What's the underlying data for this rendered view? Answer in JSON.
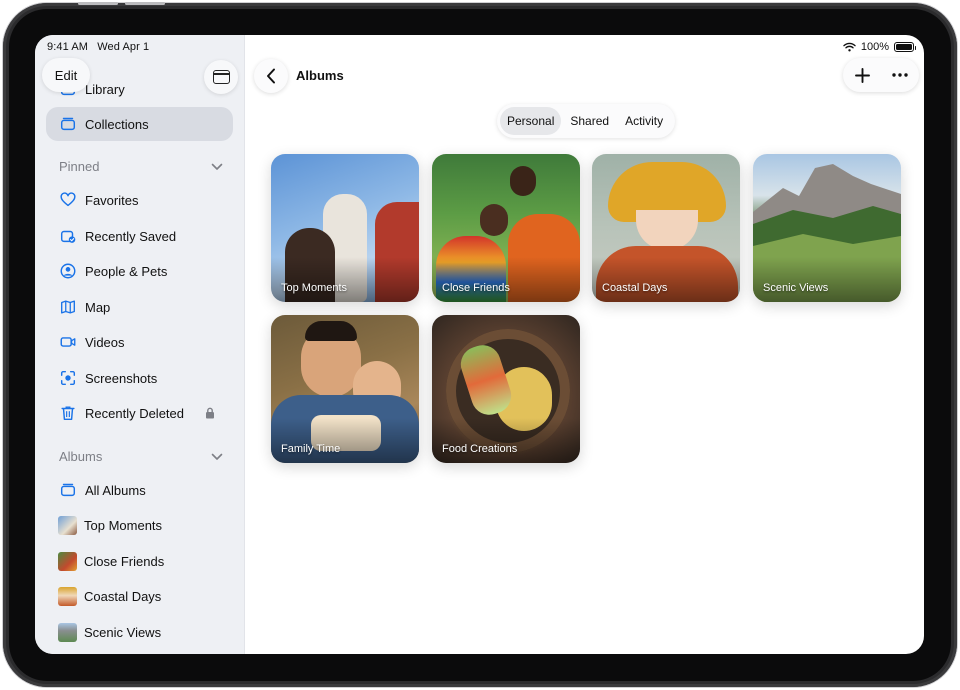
{
  "status": {
    "time": "9:41 AM",
    "date": "Wed Apr 1",
    "battery": "100%"
  },
  "sidebar": {
    "edit_label": "Edit",
    "items_top": [
      {
        "label": "Library",
        "icon": "library-icon"
      },
      {
        "label": "Collections",
        "icon": "collections-icon",
        "selected": true
      }
    ],
    "pinned_header": "Pinned",
    "pinned": [
      {
        "label": "Favorites",
        "icon": "heart-icon"
      },
      {
        "label": "Recently Saved",
        "icon": "recently-saved-icon"
      },
      {
        "label": "People & Pets",
        "icon": "person-circle-icon"
      },
      {
        "label": "Map",
        "icon": "map-icon"
      },
      {
        "label": "Videos",
        "icon": "video-icon"
      },
      {
        "label": "Screenshots",
        "icon": "screenshot-icon"
      },
      {
        "label": "Recently Deleted",
        "icon": "trash-icon",
        "locked": true
      }
    ],
    "albums_header": "Albums",
    "albums": [
      {
        "label": "All Albums",
        "icon": "albums-icon"
      },
      {
        "label": "Top Moments",
        "thumb": "#6f9fd6"
      },
      {
        "label": "Close Friends",
        "thumb": "#c24a2e"
      },
      {
        "label": "Coastal Days",
        "thumb": "#c35a2a"
      },
      {
        "label": "Scenic Views",
        "thumb": "#5d8a52"
      }
    ]
  },
  "main": {
    "title": "Albums",
    "segments": [
      {
        "label": "Personal",
        "active": true
      },
      {
        "label": "Shared",
        "active": false
      },
      {
        "label": "Activity",
        "active": false
      }
    ],
    "albums": [
      {
        "title": "Top Moments",
        "art": "art-top"
      },
      {
        "title": "Close Friends",
        "art": "art-friends"
      },
      {
        "title": "Coastal Days",
        "art": "art-coastal"
      },
      {
        "title": "Scenic Views",
        "art": "art-scenic"
      },
      {
        "title": "Family Time",
        "art": "art-family"
      },
      {
        "title": "Food Creations",
        "art": "art-food"
      }
    ]
  },
  "colors": {
    "accent": "#1a73e8",
    "sidebar_bg": "#eef0f4",
    "selected_bg": "#d8dbe2"
  }
}
